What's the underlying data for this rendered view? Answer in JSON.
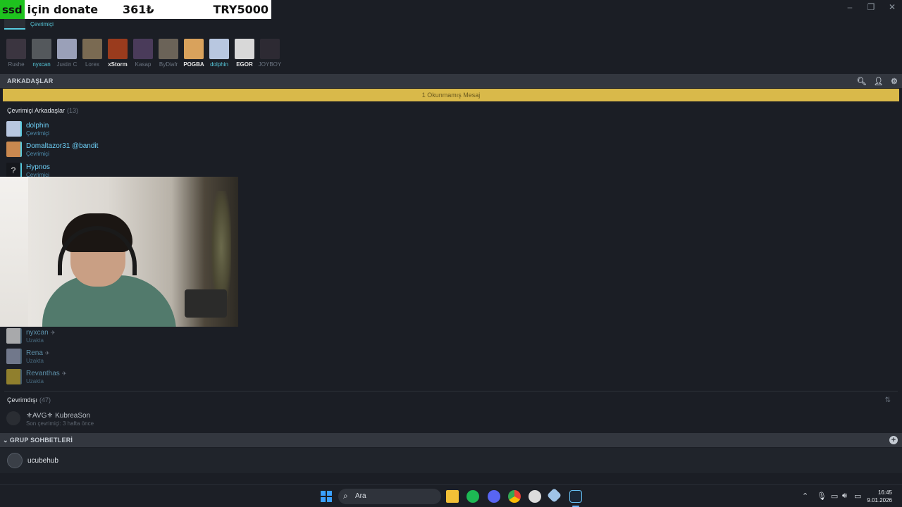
{
  "donation": {
    "tag": "ssd",
    "text": "için donate",
    "amount": "361₺",
    "goal": "TRY5000"
  },
  "window_controls": [
    "–",
    "❐",
    "✕"
  ],
  "self": {
    "status": "Çevrimiçi"
  },
  "favorites": [
    {
      "name": "Rushe",
      "color": "#3b3540",
      "style": "away"
    },
    {
      "name": "nyxcan",
      "color": "#54585c",
      "style": "on"
    },
    {
      "name": "Justin C",
      "color": "#9aa0b8",
      "style": "away"
    },
    {
      "name": "Lorex",
      "color": "#7a6a52",
      "style": "away"
    },
    {
      "name": "xStorm",
      "color": "#9a3b1d",
      "style": "game"
    },
    {
      "name": "Kasap",
      "color": "#4a3b5a",
      "style": "away"
    },
    {
      "name": "ByDiafr",
      "color": "#6b6358",
      "style": "away"
    },
    {
      "name": "POGBA",
      "color": "#d9a25c",
      "style": "game"
    },
    {
      "name": "dolphin",
      "color": "#b8c7e0",
      "style": "on"
    },
    {
      "name": "EGOR",
      "color": "#d8d8d8",
      "style": "game"
    },
    {
      "name": "JOYBOY",
      "color": "#2d2a33",
      "style": "away"
    }
  ],
  "friends_bar": {
    "title": "ARKADAŞLAR",
    "search_icon": "search-icon",
    "add_icon": "add-friend-icon",
    "settings_icon": "settings-icon"
  },
  "unread": "1 Okunmamış Mesaj",
  "online_section": {
    "title": "Çevrimiçi Arkadaşlar",
    "count": "(13)"
  },
  "online_friends": [
    {
      "name": "dolphin",
      "status": "Çevrimiçi",
      "avatar_color": "#b8c7e0"
    },
    {
      "name": "Domaltazor31 @bandit",
      "status": "Çevrimiçi",
      "avatar_color": "#c9884f"
    },
    {
      "name": "Hypnos",
      "status": "Çevrimiçi",
      "avatar_glyph": "?",
      "avatar_color": "#15171c"
    }
  ],
  "away_friends": [
    {
      "name": "nyxcan",
      "status": "Uzakta",
      "avatar_color": "#d8d8d8"
    },
    {
      "name": "Rena",
      "status": "Uzakta",
      "avatar_color": "#8e97ad"
    },
    {
      "name": "Revanthas",
      "status": "Uzakta",
      "avatar_color": "#b8a030"
    }
  ],
  "offline_section": {
    "title": "Çevrimdışı",
    "count": "(47)"
  },
  "offline_friends": [
    {
      "name": "⚜AVG⚜ KubreaSon",
      "status": "Son çevrimiçi: 3 hafta önce"
    }
  ],
  "group_bar": {
    "title": "GRUP SOHBETLERİ",
    "chevron": "⌄",
    "add": "+"
  },
  "groups": [
    {
      "name": "ucubehub"
    }
  ],
  "taskbar": {
    "search_placeholder": "Ara",
    "time": "16:45",
    "date": "9.01.2026"
  }
}
